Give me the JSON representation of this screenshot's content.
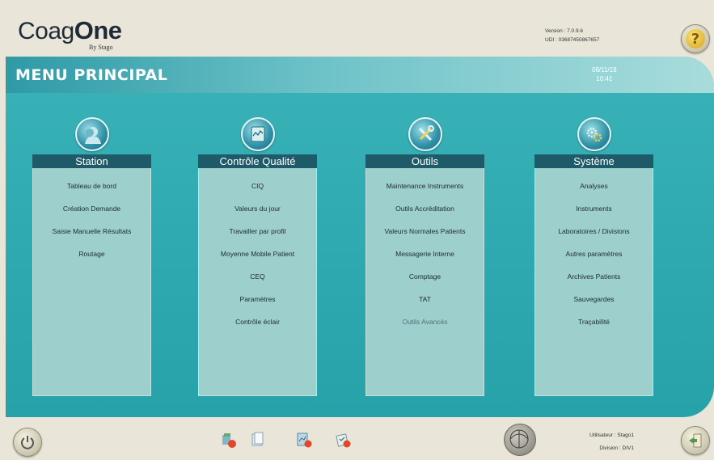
{
  "app": {
    "logo_main": "CoagOne",
    "logo_sub": "By Stago",
    "version": "Version : 7.0.9.6",
    "udi": "UDI : 03687450867657"
  },
  "header": {
    "title": "MENU PRINCIPAL",
    "date": "08/11/19",
    "time": "10:41"
  },
  "columns": [
    {
      "name": "Station",
      "icon": "user-profile-icon",
      "items": [
        "Tableau de bord",
        "Création Demande",
        "Saisie Manuelle Résultats",
        "Routage"
      ]
    },
    {
      "name": "Contrôle Qualité",
      "icon": "quality-chart-icon",
      "items": [
        "CIQ",
        "Valeurs du jour",
        "Travailler par profil",
        "Moyenne Mobile Patient",
        "CEQ",
        "Paramètres",
        "Contrôle éclair"
      ]
    },
    {
      "name": "Outils",
      "icon": "tools-icon",
      "items": [
        "Maintenance Instruments",
        "Outils Accréditation",
        "Valeurs Normales Patients",
        "Messagerie Interne",
        "Comptage",
        "TAT",
        "Outils Avancés"
      ]
    },
    {
      "name": "Système",
      "icon": "gears-icon",
      "items": [
        "Analyses",
        "Instruments",
        "Laboratoires / Divisions",
        "Autres paramètres",
        "Archives Patients",
        "Sauvegardes",
        "Traçabilité"
      ]
    }
  ],
  "footer": {
    "user": "Utilisateur : Stago1",
    "division": "Division : DIV1"
  },
  "colors": {
    "panel": "#2eaab0",
    "column_header": "#1f5a68",
    "column_body": "#9dcfcd",
    "background": "#e9e6d9"
  }
}
